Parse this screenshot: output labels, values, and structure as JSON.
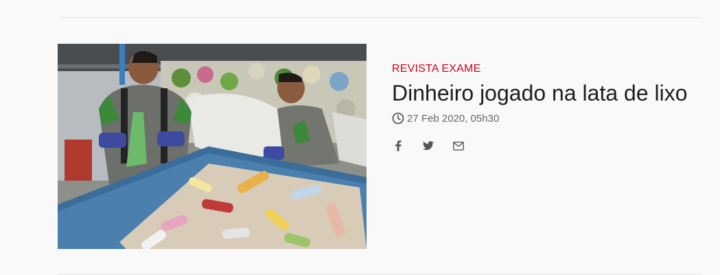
{
  "article": {
    "source": "REVISTA EXAME",
    "headline": "Dinheiro jogado na lata de lixo",
    "date": "27 Feb 2020, 05h30",
    "image_icon": "recycling-workers-photo"
  },
  "share": {
    "icons": [
      "facebook-icon",
      "twitter-icon",
      "email-icon"
    ]
  },
  "colors": {
    "accent": "#d0021b",
    "text": "#1e1e1e",
    "muted": "#666666",
    "background": "#f9f9f9"
  }
}
